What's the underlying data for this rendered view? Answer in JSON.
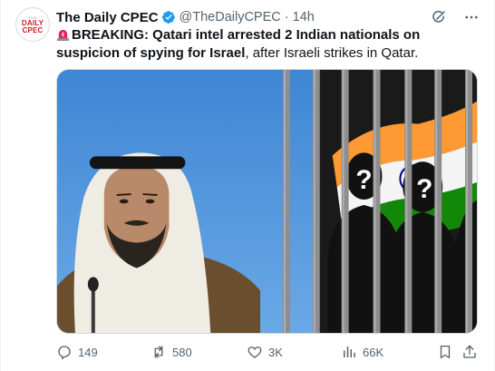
{
  "tweet": {
    "author": {
      "display_name": "The Daily CPEC",
      "handle": "@TheDailyCPEC",
      "verified": true,
      "avatar_text_top": "THE",
      "avatar_text_line1": "DAILY",
      "avatar_text_line2": "CPEC"
    },
    "separator": "·",
    "time": "14h",
    "text": {
      "lead": "BREAKING: ",
      "bold": "Qatari intel arrested 2 Indian nationals on suspicion of spying for Israel",
      "rest": ", after Israeli strikes in Qatar."
    },
    "media": {
      "overlay_mark": "?"
    },
    "actions": {
      "replies": "149",
      "reposts": "580",
      "likes": "3K",
      "views": "66K"
    }
  },
  "colors": {
    "verified": "#1d9bf0",
    "text": "#0f1419",
    "secondary": "#536471",
    "siren": "#e0245e",
    "saffron": "#ff9933",
    "india_green": "#138808",
    "chakra": "#000080",
    "photo_blue": "#4a8fd6"
  },
  "icons": [
    "verified-badge-icon",
    "grok-icon",
    "more-icon",
    "siren-icon",
    "reply-icon",
    "repost-icon",
    "like-icon",
    "views-icon",
    "bookmark-icon",
    "share-icon"
  ]
}
